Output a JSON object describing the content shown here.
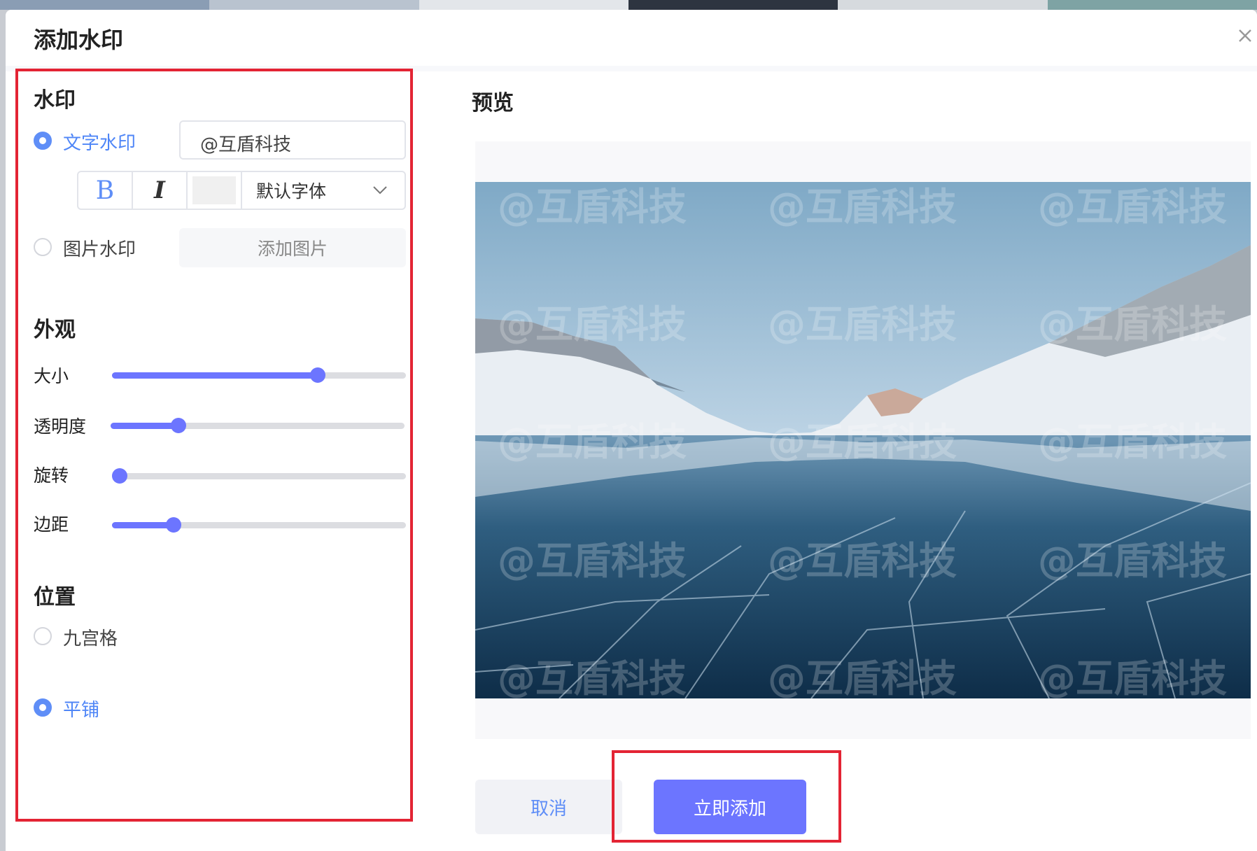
{
  "dialog": {
    "title": "添加水印"
  },
  "watermark": {
    "section_title": "水印",
    "text_option": {
      "label": "文字水印",
      "selected": true,
      "value": "@互盾科技"
    },
    "toolbar": {
      "bold_label": "B",
      "italic_label": "I",
      "font_label": "默认字体"
    },
    "image_option": {
      "label": "图片水印",
      "selected": false,
      "button_label": "添加图片"
    }
  },
  "appearance": {
    "section_title": "外观",
    "sliders": [
      {
        "label": "大小",
        "value": 0.7
      },
      {
        "label": "透明度",
        "value": 0.23
      },
      {
        "label": "旋转",
        "value": 0.0
      },
      {
        "label": "边距",
        "value": 0.21
      }
    ]
  },
  "position": {
    "section_title": "位置",
    "options": [
      {
        "label": "九宫格",
        "selected": false
      },
      {
        "label": "平铺",
        "selected": true
      }
    ]
  },
  "preview": {
    "title": "预览",
    "watermark_text": "@互盾科技"
  },
  "actions": {
    "cancel_label": "取消",
    "confirm_label": "立即添加"
  }
}
